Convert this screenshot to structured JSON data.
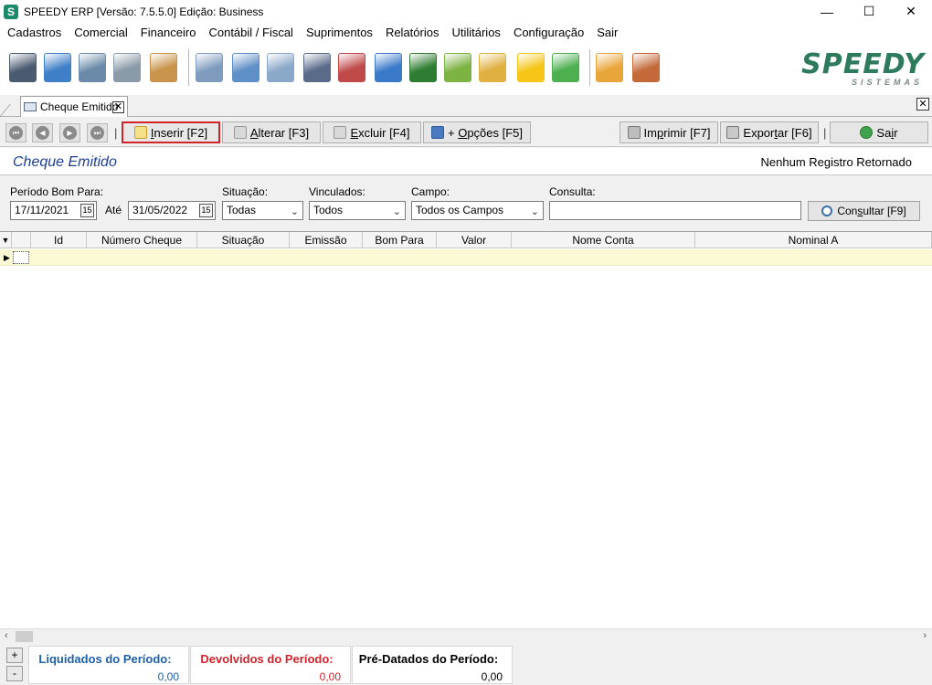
{
  "window": {
    "title": "SPEEDY ERP [Versão: 7.5.5.0] Edição: Business",
    "app_icon_letter": "S",
    "minimize": "—",
    "maximize": "☐",
    "close": "✕"
  },
  "menu": [
    "Cadastros",
    "Comercial",
    "Financeiro",
    "Contábil / Fiscal",
    "Suprimentos",
    "Relatórios",
    "Utilitários",
    "Configuração",
    "Sair"
  ],
  "logo": {
    "main": "SPEEDY",
    "sub": "SISTEMAS"
  },
  "toolbar_icons": [
    {
      "name": "user-dark-icon",
      "color": "#4a5a70"
    },
    {
      "name": "user-blue-icon",
      "color": "#3f7fc8"
    },
    {
      "name": "users-group-icon",
      "color": "#6a8aa8"
    },
    {
      "name": "truck-icon",
      "color": "#8a9aa8"
    },
    {
      "name": "box-icon",
      "color": "#c8934a"
    },
    {
      "name": "calculator-sheet-icon",
      "color": "#7f9cbf"
    },
    {
      "name": "document-list-icon",
      "color": "#5f8fc7"
    },
    {
      "name": "spreadsheet-icon",
      "color": "#8aa8c8"
    },
    {
      "name": "report-icon",
      "color": "#5a6b8a"
    },
    {
      "name": "html-document-icon",
      "color": "#c04a4a"
    },
    {
      "name": "internet-explorer-icon",
      "color": "#3a7ac8"
    },
    {
      "name": "green-book-icon",
      "color": "#2e7d32"
    },
    {
      "name": "money-icon",
      "color": "#7cb342"
    },
    {
      "name": "credit-card-icon",
      "color": "#e0b040"
    },
    {
      "name": "yellow-folder-icon",
      "color": "#f5c518"
    },
    {
      "name": "green-note-icon",
      "color": "#4caf50"
    },
    {
      "name": "keys-user-icon",
      "color": "#e8a63a"
    },
    {
      "name": "exit-door-icon",
      "color": "#c46a3a"
    }
  ],
  "tab": {
    "label": "Cheque Emitido",
    "close": "✕"
  },
  "strip_close": "✕",
  "actions": {
    "insert": {
      "mnemonic": "I",
      "rest": "nserir [F2]"
    },
    "alter": {
      "mnemonic": "A",
      "rest": "lterar [F3]"
    },
    "delete": {
      "mnemonic": "E",
      "rest": "xcluir [F4]"
    },
    "options": {
      "pre": "+ ",
      "mnemonic": "O",
      "rest": "pções [F5]"
    },
    "print": {
      "pre": "Im",
      "mnemonic": "p",
      "rest": "rimir [F7]"
    },
    "export": {
      "pre": "Expor",
      "mnemonic": "t",
      "rest": "ar [F6]"
    },
    "exit": {
      "pre": "Sa",
      "mnemonic": "i",
      "rest": "r"
    }
  },
  "nav_buttons": [
    "⏮",
    "◀",
    "▶",
    "⏭"
  ],
  "pipe": "|",
  "form_title": "Cheque Emitido",
  "status_message": "Nenhum Registro Retornado",
  "filters": {
    "period_label": "Período Bom Para:",
    "date_from": "17/11/2021",
    "ate_label": "Até",
    "date_to": "31/05/2022",
    "situation_label": "Situação:",
    "situation_value": "Todas",
    "linked_label": "Vinculados:",
    "linked_value": "Todos",
    "field_label": "Campo:",
    "field_value": "Todos os Campos",
    "query_label": "Consulta:",
    "query_value": "",
    "consult_button": {
      "pre": "Con",
      "mnemonic": "s",
      "rest": "ultar [F9]"
    },
    "calendar_glyph": "15",
    "dropdown_glyph": "⌄"
  },
  "grid": {
    "columns": [
      "",
      "Id",
      "Número Cheque",
      "Situação",
      "Emissão",
      "Bom Para",
      "Valor",
      "Nome Conta",
      "Nominal A"
    ],
    "rows": [],
    "row_indicator": "▶",
    "sort_glyph": "▼"
  },
  "scroll": {
    "left": "‹",
    "right": "›"
  },
  "footer": {
    "plus": "+",
    "minus": "-",
    "totals": [
      {
        "label": "Liquidados do Período:",
        "value": "0,00",
        "color": "#1f5fa8"
      },
      {
        "label": "Devolvidos do Período:",
        "value": "0,00",
        "color": "#d2232a"
      },
      {
        "label": "Pré-Datados do Período:",
        "value": "0,00",
        "color": "#000000"
      }
    ]
  }
}
